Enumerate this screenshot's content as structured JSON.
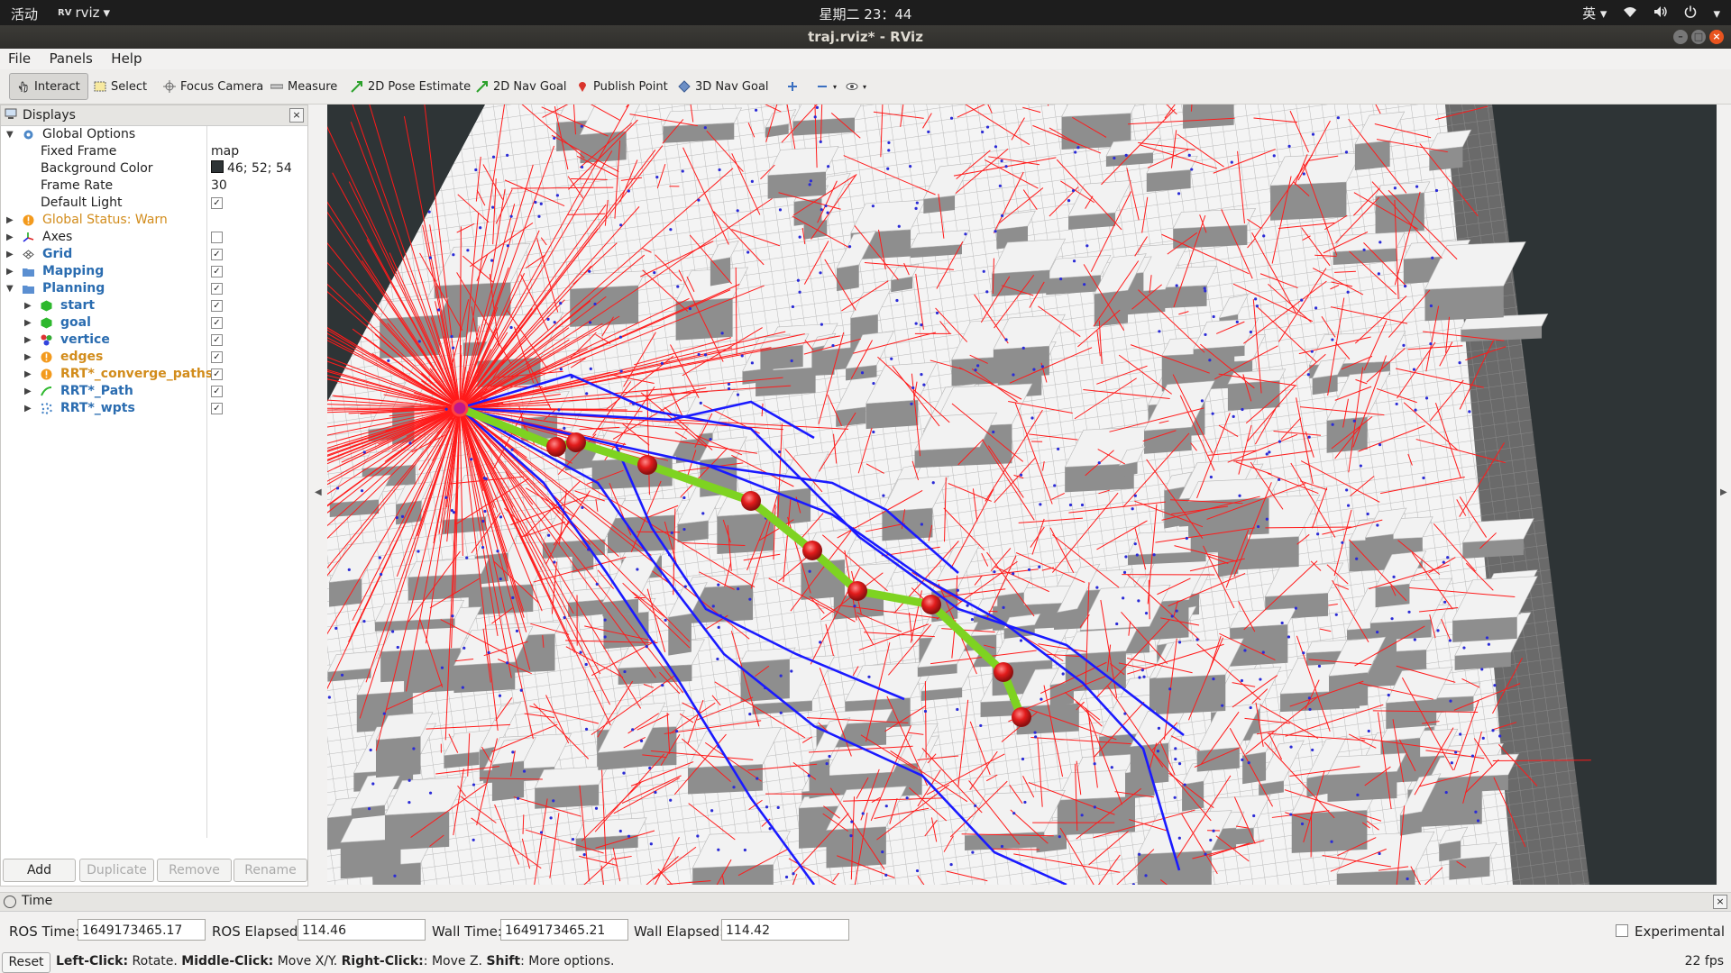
{
  "topbar": {
    "activities": "活动",
    "app_name": "rviz",
    "clock": "星期二 23：44",
    "input_method": "英"
  },
  "window": {
    "title": "traj.rviz* - RViz"
  },
  "menu": [
    "File",
    "Panels",
    "Help"
  ],
  "toolbar": {
    "interact": "Interact",
    "select": "Select",
    "focus_camera": "Focus Camera",
    "measure": "Measure",
    "pose_estimate": "2D Pose Estimate",
    "nav_goal_2d": "2D Nav Goal",
    "publish_point": "Publish Point",
    "nav_goal_3d": "3D Nav Goal"
  },
  "displays": {
    "title": "Displays",
    "global_options": {
      "label": "Global Options",
      "fixed_frame_label": "Fixed Frame",
      "fixed_frame": "map",
      "bg_color_label": "Background Color",
      "bg_color": "46; 52; 54",
      "bg_color_hex": "#2e3436",
      "frame_rate_label": "Frame Rate",
      "frame_rate": "30",
      "default_light_label": "Default Light",
      "default_light": true
    },
    "global_status": "Global Status: Warn",
    "items": [
      {
        "label": "Axes",
        "checked": false
      },
      {
        "label": "Grid",
        "checked": true
      },
      {
        "label": "Mapping",
        "checked": true
      },
      {
        "label": "Planning",
        "checked": true
      }
    ],
    "planning_children": [
      {
        "label": "start",
        "checked": true
      },
      {
        "label": "goal",
        "checked": true
      },
      {
        "label": "vertice",
        "checked": true
      },
      {
        "label": "edges",
        "checked": true
      },
      {
        "label": "RRT*_converge_paths",
        "checked": true
      },
      {
        "label": "RRT*_Path",
        "checked": true
      },
      {
        "label": "RRT*_wpts",
        "checked": true
      }
    ],
    "buttons": {
      "add": "Add",
      "duplicate": "Duplicate",
      "remove": "Remove",
      "rename": "Rename"
    }
  },
  "time": {
    "title": "Time",
    "ros_time_label": "ROS Time:",
    "ros_time": "1649173465.17",
    "ros_elapsed_label": "ROS Elapsed:",
    "ros_elapsed": "114.46",
    "wall_time_label": "Wall Time:",
    "wall_time": "1649173465.21",
    "wall_elapsed_label": "Wall Elapsed:",
    "wall_elapsed": "114.42",
    "experimental_label": "Experimental"
  },
  "status": {
    "reset": "Reset",
    "hint_left_key": "Left-Click:",
    "hint_left": " Rotate. ",
    "hint_mid_key": "Middle-Click:",
    "hint_mid": " Move X/Y. ",
    "hint_right_key": "Right-Click:",
    "hint_right": ": Move Z. ",
    "hint_shift_key": "Shift",
    "hint_shift": ": More options.",
    "fps": "22 fps"
  },
  "colors": {
    "edges": "#ff1a1a",
    "converge_paths": "#1a1aff",
    "path": "#7ed321",
    "waypoints": "#e21c1c",
    "start": "#c0188a"
  }
}
